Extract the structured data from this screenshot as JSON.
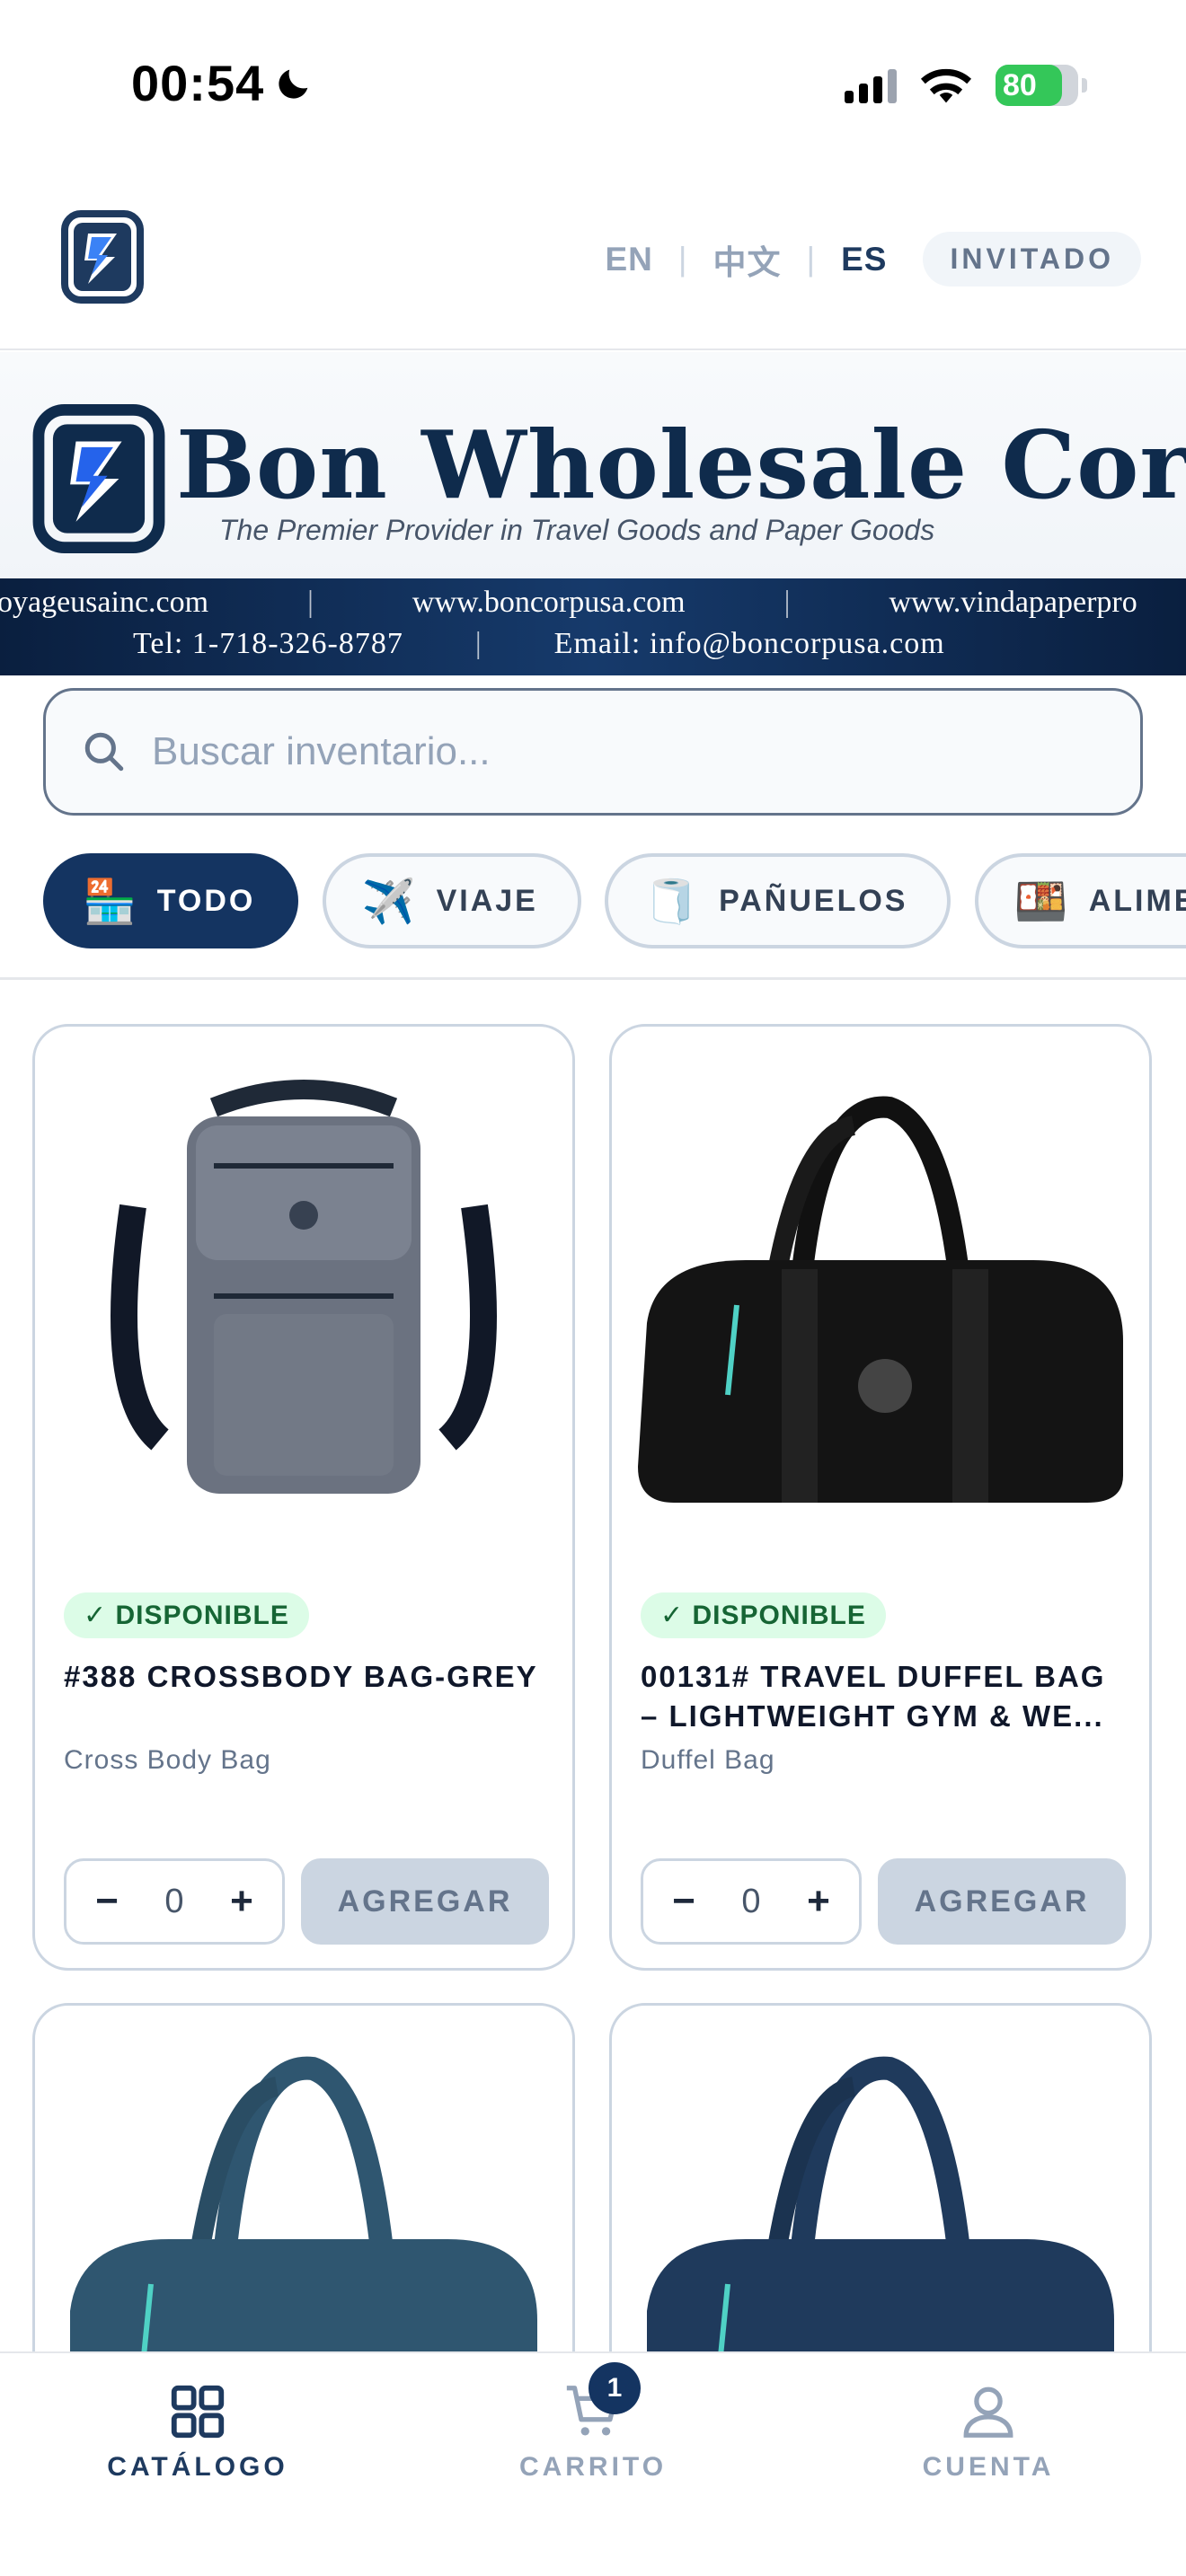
{
  "status_bar": {
    "time": "00:54",
    "battery": "80"
  },
  "header": {
    "languages": [
      {
        "code": "EN",
        "active": false
      },
      {
        "code": "中文",
        "active": false
      },
      {
        "code": "ES",
        "active": true
      }
    ],
    "guest_label": "INVITADO"
  },
  "banner": {
    "title": "Bon Wholesale Corp",
    "tagline": "The Premier Provider in Travel Goods and Paper Goods",
    "websites": [
      "voyageusainc.com",
      "www.boncorpusa.com",
      "www.vindapaperpro"
    ],
    "tel": "Tel: 1-718-326-8787",
    "email": "Email: info@boncorpusa.com"
  },
  "search": {
    "placeholder": "Buscar inventario..."
  },
  "categories": [
    {
      "label": "TODO",
      "emoji": "🏪",
      "active": true
    },
    {
      "label": "VIAJE",
      "emoji": "✈️",
      "active": false
    },
    {
      "label": "PAÑUELOS",
      "emoji": "🧻",
      "active": false
    },
    {
      "label": "ALIMEN",
      "emoji": "🍱",
      "active": false
    }
  ],
  "products": [
    {
      "status": "✓ DISPONIBLE",
      "title": "#388 CROSSBODY BAG-GREY",
      "subtitle": "Cross Body Bag",
      "quantity": "0",
      "add_label": "AGREGAR",
      "color": "#6b7280"
    },
    {
      "status": "✓ DISPONIBLE",
      "title": "00131# TRAVEL DUFFEL BAG – LIGHTWEIGHT GYM & WE...",
      "subtitle": "Duffel Bag",
      "quantity": "0",
      "add_label": "AGREGAR",
      "color": "#111111"
    },
    {
      "status": "",
      "title": "",
      "subtitle": "",
      "quantity": "",
      "add_label": "",
      "color": "#2f5670"
    },
    {
      "status": "",
      "title": "",
      "subtitle": "",
      "quantity": "",
      "add_label": "",
      "color": "#1f3a5c"
    }
  ],
  "bottom_nav": {
    "catalog_label": "CATÁLOGO",
    "cart_label": "CARRITO",
    "cart_count": "1",
    "account_label": "CUENTA"
  },
  "colors": {
    "primary": "#143461",
    "success_bg": "#dcfce7",
    "success_text": "#166534",
    "muted": "#94a3b8"
  }
}
